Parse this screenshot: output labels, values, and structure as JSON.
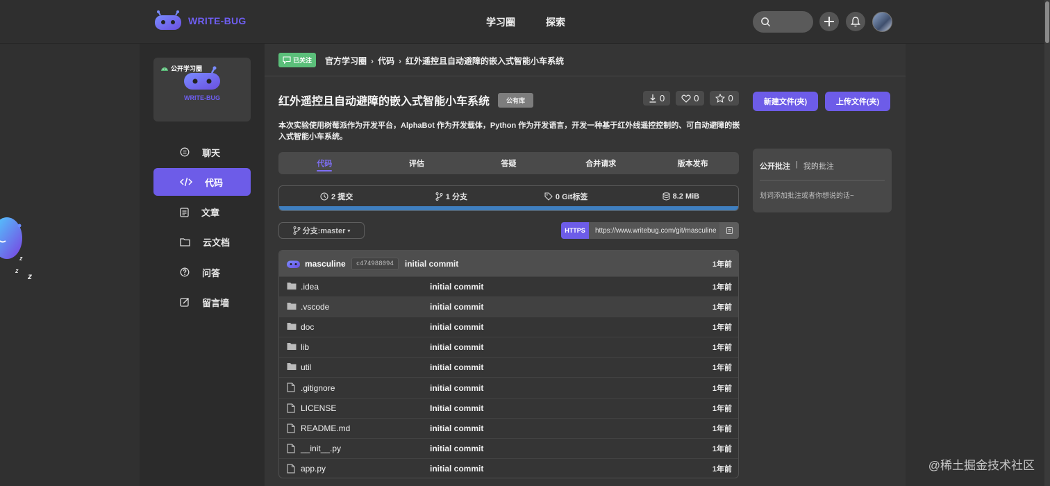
{
  "brand": {
    "name": "WRITE-BUG",
    "accent": "#6d5ce8"
  },
  "top_nav": {
    "items": [
      "学习圈",
      "探索"
    ]
  },
  "sidebar": {
    "circle": {
      "tag": "公开学习圈",
      "name": "WRITE-BUG"
    },
    "items": [
      {
        "label": "聊天",
        "icon": "chat-icon"
      },
      {
        "label": "代码",
        "icon": "code-icon",
        "active": true
      },
      {
        "label": "文章",
        "icon": "article-icon"
      },
      {
        "label": "云文档",
        "icon": "folder-icon"
      },
      {
        "label": "问答",
        "icon": "question-icon"
      },
      {
        "label": "留言墙",
        "icon": "edit-icon"
      }
    ]
  },
  "breadcrumb": {
    "follow_label": "已关注",
    "items": [
      "官方学习圈",
      "代码",
      "红外遥控且自动避障的嵌入式智能小车系统"
    ]
  },
  "repo": {
    "title": "红外遥控且自动避障的嵌入式智能小车系统",
    "visibility": "公有库",
    "downloads": "0",
    "likes": "0",
    "stars": "0",
    "description": "本次实验使用树莓派作为开发平台，AlphaBot 作为开发载体，Python 作为开发语言，开发一种基于红外线遥控控制的、可自动避障的嵌入式智能小车系统。"
  },
  "tabs": [
    "代码",
    "评估",
    "答疑",
    "合并请求",
    "版本发布"
  ],
  "stats": {
    "commits": "2 提交",
    "branches": "1 分支",
    "tags": "0 Git标签",
    "size": "8.2 MiB"
  },
  "branch_selector": "分支:master",
  "clone": {
    "protocol": "HTTPS",
    "url": "https://www.writebug.com/git/masculine"
  },
  "latest_commit": {
    "author": "masculine",
    "hash": "c474988094",
    "message": "initial commit",
    "time": "1年前"
  },
  "files": [
    {
      "name": ".idea",
      "type": "folder",
      "message": "initial commit",
      "time": "1年前"
    },
    {
      "name": ".vscode",
      "type": "folder",
      "message": "initial commit",
      "time": "1年前"
    },
    {
      "name": "doc",
      "type": "folder",
      "message": "initial commit",
      "time": "1年前"
    },
    {
      "name": "lib",
      "type": "folder",
      "message": "initial commit",
      "time": "1年前"
    },
    {
      "name": "util",
      "type": "folder",
      "message": "initial commit",
      "time": "1年前"
    },
    {
      "name": ".gitignore",
      "type": "file",
      "message": "initial commit",
      "time": "1年前"
    },
    {
      "name": "LICENSE",
      "type": "file",
      "message": "Initial commit",
      "time": "1年前"
    },
    {
      "name": "README.md",
      "type": "file",
      "message": "initial commit",
      "time": "1年前"
    },
    {
      "name": "__init__.py",
      "type": "file",
      "message": "initial commit",
      "time": "1年前"
    },
    {
      "name": "app.py",
      "type": "file",
      "message": "initial commit",
      "time": "1年前"
    }
  ],
  "actions": {
    "new_file": "新建文件(夹)",
    "upload_file": "上传文件(夹)"
  },
  "notes": {
    "tab_public": "公开批注",
    "separator": "|",
    "tab_mine": "我的批注",
    "placeholder": "划词添加批注或者你想说的话~"
  },
  "watermark": "@稀土掘金技术社区"
}
